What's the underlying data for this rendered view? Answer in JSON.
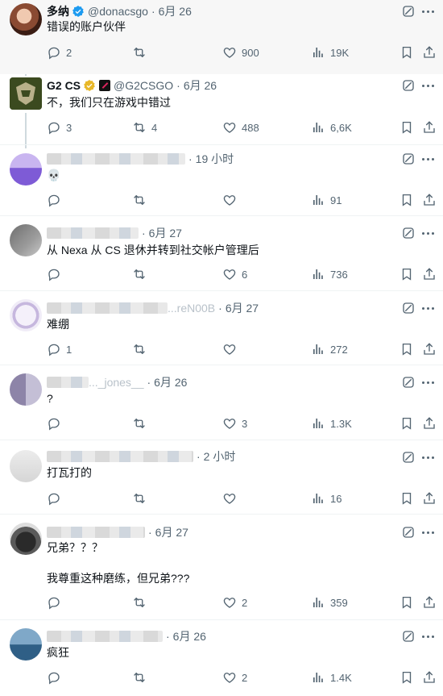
{
  "tweets": [
    {
      "name": "多纳",
      "handle": "@donacsgo",
      "time": "6月 26",
      "text": "错误的账户伙伴",
      "replies": "2",
      "retweets": "",
      "likes": "900",
      "views": "19K",
      "avatar": "dona"
    },
    {
      "name": "G2 CS",
      "handle": "@G2CSGO",
      "time": "6月 26",
      "text": "不，我们只在游戏中错过",
      "replies": "3",
      "retweets": "4",
      "likes": "488",
      "views": "6,6K",
      "avatar": "g2"
    },
    {
      "name": "",
      "handle": "",
      "time": "19 小时",
      "text": "💀",
      "replies": "",
      "retweets": "",
      "likes": "",
      "views": "91",
      "avatar": "purple"
    },
    {
      "name": "",
      "handle": "",
      "time": "6月 27",
      "text": "从 Nexa 从 CS 退休并转到社交帐户管理后",
      "replies": "",
      "retweets": "",
      "likes": "6",
      "views": "736",
      "avatar": "gray1"
    },
    {
      "name": "",
      "handle": "...reN00B",
      "time": "6月 27",
      "text": "难绷",
      "replies": "1",
      "retweets": "",
      "likes": "",
      "views": "272",
      "avatar": "ring"
    },
    {
      "name": "",
      "handle": "..._jones__",
      "time": "6月 26",
      "text": "?",
      "replies": "",
      "retweets": "",
      "likes": "3",
      "views": "1.3K",
      "avatar": "mosaic"
    },
    {
      "name": "",
      "handle": "",
      "time": "2 小时",
      "text": "打瓦打的",
      "replies": "",
      "retweets": "",
      "likes": "",
      "views": "16",
      "avatar": "light"
    },
    {
      "name": "",
      "handle": "",
      "time": "6月 27",
      "text": "兄弟？？？",
      "text2": "我尊重这种磨练，但兄弟???",
      "replies": "",
      "retweets": "",
      "likes": "2",
      "views": "359",
      "avatar": "dark"
    },
    {
      "name": "",
      "handle": "",
      "time": "6月 26",
      "text": "疯狂",
      "replies": "",
      "retweets": "",
      "likes": "2",
      "views": "1.4K",
      "avatar": "blue"
    }
  ],
  "icons": {
    "reply": "reply-icon",
    "retweet": "retweet-icon",
    "like": "heart-icon",
    "views": "views-icon",
    "bookmark": "bookmark-icon",
    "share": "share-icon",
    "grok": "grok-icon",
    "more": "more-icon"
  }
}
